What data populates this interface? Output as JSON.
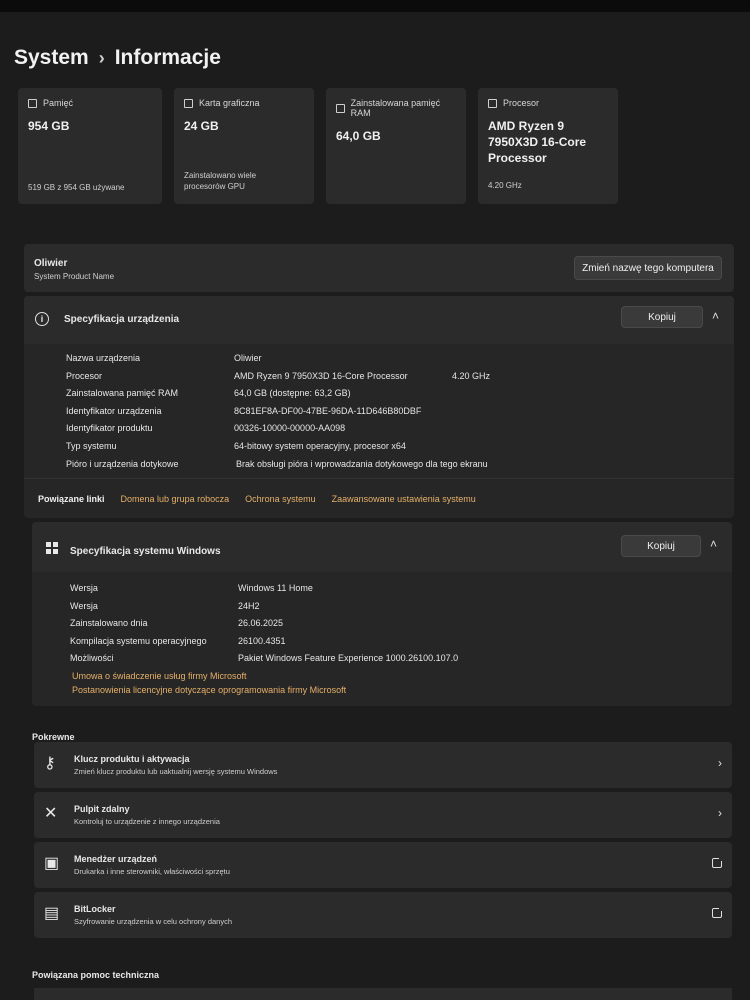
{
  "breadcrumb": {
    "parent": "System",
    "separator": "›",
    "current": "Informacje"
  },
  "cards": [
    {
      "icon": "storage-icon",
      "title": "Pamięć",
      "value": "954 GB",
      "sub": "519 GB z 954 GB używane"
    },
    {
      "icon": "gpu-icon",
      "title": "Karta graficzna",
      "value": "24 GB",
      "sub": "Zainstalowano wiele procesorów GPU"
    },
    {
      "icon": "ram-icon",
      "title": "Zainstalowana pamięć RAM",
      "value": "64,0 GB",
      "sub": ""
    },
    {
      "icon": "cpu-icon",
      "title": "Procesor",
      "value": "AMD Ryzen 9 7950X3D 16-Core Processor",
      "sub": "4.20 GHz"
    }
  ],
  "device": {
    "name": "Oliwier",
    "product": "System Product Name",
    "rename_label": "Zmień nazwę tego komputera"
  },
  "device_spec": {
    "title": "Specyfikacja urządzenia",
    "copy_label": "Kopiuj",
    "rows": [
      {
        "k": "Nazwa urządzenia",
        "v": "Oliwier"
      },
      {
        "k": "Procesor",
        "v": "AMD Ryzen 9 7950X3D 16-Core Processor",
        "extra": "4.20 GHz"
      },
      {
        "k": "Zainstalowana pamięć RAM",
        "v": "64,0 GB (dostępne: 63,2 GB)"
      },
      {
        "k": "Identyfikator urządzenia",
        "v": "8C81EF8A-DF00-47BE-96DA-11D646B80DBF"
      },
      {
        "k": "Identyfikator produktu",
        "v": "00326-10000-00000-AA098"
      },
      {
        "k": "Typ systemu",
        "v": "64-bitowy system operacyjny, procesor x64"
      },
      {
        "k": "Pióro i urządzenia dotykowe",
        "v": "Brak obsługi pióra i wprowadzania dotykowego dla tego ekranu"
      }
    ]
  },
  "related_links": {
    "label": "Powiązane linki",
    "links": [
      "Domena lub grupa robocza",
      "Ochrona systemu",
      "Zaawansowane ustawienia systemu"
    ]
  },
  "windows_spec": {
    "title": "Specyfikacja systemu Windows",
    "copy_label": "Kopiuj",
    "rows": [
      {
        "k": "Wersja",
        "v": "Windows 11 Home"
      },
      {
        "k": "Wersja",
        "v": "24H2"
      },
      {
        "k": "Zainstalowano dnia",
        "v": "26.06.2025"
      },
      {
        "k": "Kompilacja systemu operacyjnego",
        "v": "26100.4351"
      },
      {
        "k": "Możliwości",
        "v": "Pakiet Windows Feature Experience 1000.26100.107.0"
      }
    ],
    "links": [
      "Umowa o świadczenie usług firmy Microsoft",
      "Postanowienia licencyjne dotyczące oprogramowania firmy Microsoft"
    ]
  },
  "related": {
    "heading": "Pokrewne",
    "items": [
      {
        "title": "Klucz produktu i aktywacja",
        "desc": "Zmień klucz produktu lub uaktualnij wersję systemu Windows",
        "icon": "key-icon"
      },
      {
        "title": "Pulpit zdalny",
        "desc": "Kontroluj to urządzenie z innego urządzenia",
        "icon": "remote-desktop-icon"
      },
      {
        "title": "Menedżer urządzeń",
        "desc": "Drukarka i inne sterowniki, właściwości sprzętu",
        "icon": "device-manager-icon"
      },
      {
        "title": "BitLocker",
        "desc": "Szyfrowanie urządzenia w celu ochrony danych",
        "icon": "bitlocker-icon"
      }
    ]
  },
  "help": {
    "heading": "Powiązana pomoc techniczna"
  }
}
